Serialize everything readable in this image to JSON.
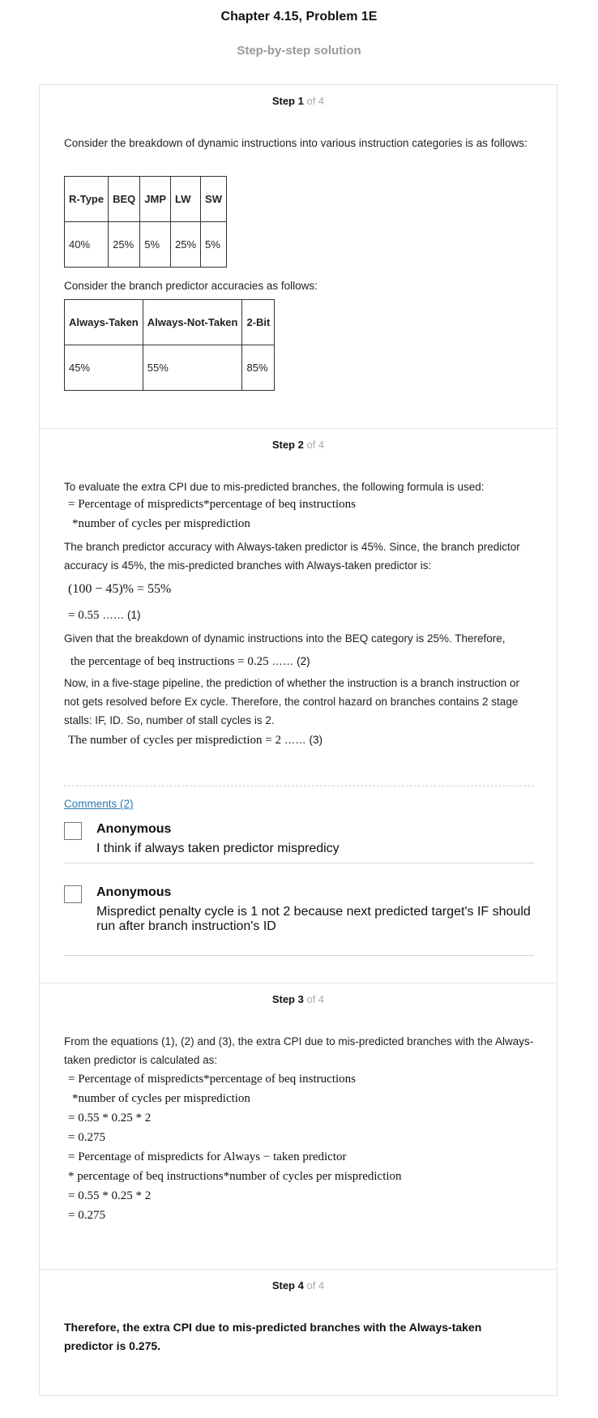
{
  "header": {
    "title": "Chapter 4.15, Problem 1E",
    "subtitle": "Step-by-step solution"
  },
  "steps": [
    {
      "label": "Step 1",
      "of": "of 4",
      "intro": "Consider the breakdown of dynamic instructions into various instruction categories is as follows:",
      "table1": {
        "headers": [
          "R-Type",
          "BEQ",
          "JMP",
          "LW",
          "SW"
        ],
        "values": [
          "40%",
          "25%",
          "5%",
          "25%",
          "5%"
        ]
      },
      "intro2": "Consider the branch predictor accuracies as follows:",
      "table2": {
        "headers": [
          "Always-Taken",
          "Always-Not-Taken",
          "2-Bit"
        ],
        "values": [
          "45%",
          "55%",
          "85%"
        ]
      }
    },
    {
      "label": "Step 2",
      "of": "of 4",
      "p1": "To evaluate the extra CPI due to mis-predicted branches, the following formula is used:",
      "m1": "= Percentage of mispredicts*percentage of beq instructions",
      "m2": "*number of cycles per misprediction",
      "p2": "The branch predictor accuracy with Always-taken predictor is 45%. Since, the branch predictor accuracy is 45%, the mis-predicted branches with Always-taken predictor is:",
      "m3": "(100 − 45)% = 55%",
      "m4": "= 0.55",
      "m4tag": "…… (1)",
      "p3": "Given that the breakdown of dynamic instructions into the BEQ category is 25%. Therefore,",
      "m5": "the percentage of beq instructions = 0.25",
      "m5tag": "…… (2)",
      "p4": "Now, in a five-stage pipeline, the prediction of whether the instruction is a branch instruction or not gets resolved before Ex cycle. Therefore, the control hazard on branches contains 2 stage stalls: IF, ID. So, number of stall cycles is 2.",
      "m6": "The number of cycles per misprediction = 2",
      "m6tag": "…… (3)",
      "comments_link": "Comments (2)",
      "comments": [
        {
          "author": "Anonymous",
          "text": "I think if always taken predictor mispredicy"
        },
        {
          "author": "Anonymous",
          "text": "Mispredict penalty cycle is 1 not 2 because next predicted target's IF should run after branch instruction's ID"
        }
      ]
    },
    {
      "label": "Step 3",
      "of": "of 4",
      "p1": "From the equations (1), (2) and (3), the extra CPI due to mis-predicted branches with the Always-taken predictor is calculated as:",
      "lines": [
        "= Percentage of mispredicts*percentage of beq instructions",
        "*number of cycles per misprediction",
        "= 0.55 * 0.25 * 2",
        "= 0.275",
        "= Percentage of mispredicts for Always − taken predictor",
        "* percentage of beq instructions*number of cycles per misprediction",
        "= 0.55 * 0.25 * 2",
        "=  0.275"
      ]
    },
    {
      "label": "Step 4",
      "of": "of 4",
      "conclusion": "Therefore, the extra CPI due to mis-predicted branches with the Always-taken predictor is 0.275."
    }
  ]
}
